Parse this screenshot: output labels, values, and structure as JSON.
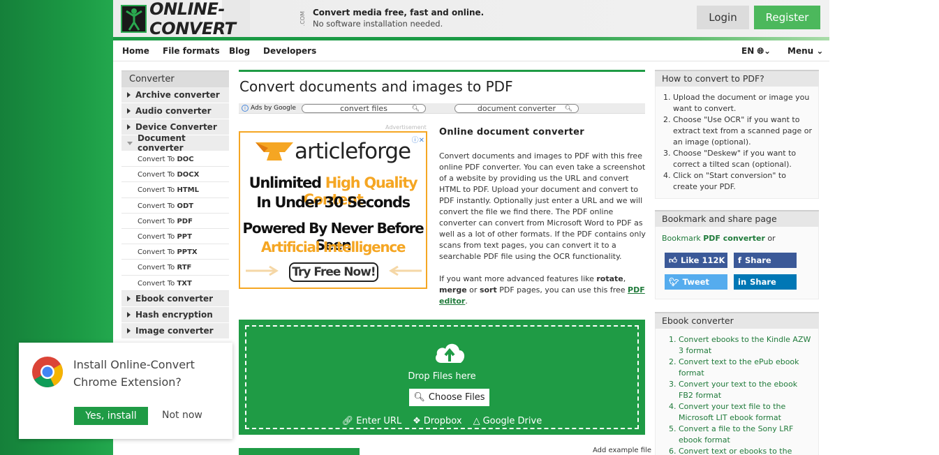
{
  "brand": {
    "logo_text": "ONLINE-CONVERT",
    "logo_suffix": ".COM",
    "tagline_main": "Convert media free, fast and online.",
    "tagline_sub": "No software installation needed."
  },
  "auth": {
    "login": "Login",
    "register": "Register"
  },
  "nav": {
    "items": [
      "Home",
      "File formats",
      "Blog",
      "Developers"
    ],
    "language": "EN",
    "menu": "Menu"
  },
  "sidebar": {
    "title": "Converter",
    "categories": [
      {
        "label": "Archive converter",
        "expanded": false
      },
      {
        "label": "Audio converter",
        "expanded": false
      },
      {
        "label": "Device Converter",
        "expanded": false
      },
      {
        "label": "Document converter",
        "expanded": true
      }
    ],
    "sub_prefix": "Convert To",
    "sub_items": [
      "DOC",
      "DOCX",
      "HTML",
      "ODT",
      "PDF",
      "PPT",
      "PPTX",
      "RTF",
      "TXT"
    ],
    "after_categories": [
      {
        "label": "Ebook converter"
      },
      {
        "label": "Hash encryption"
      },
      {
        "label": "Image converter"
      }
    ]
  },
  "main": {
    "title": "Convert documents and images to PDF",
    "ads_by": "Ads by Google",
    "ad_pills": [
      "convert files",
      "document converter"
    ],
    "advertisement_label": "Advertisement",
    "ad": {
      "brand": "articleforge",
      "line1_a": "Unlimited ",
      "line1_b": "High Quality Content",
      "line2": "In Under 30 Seconds",
      "line3": "Powered By Never Before Seen",
      "line4": "Artificial Intelligence",
      "cta": "Try Free Now!"
    },
    "desc_title": "Online document converter",
    "desc_p1": "Convert documents and images to PDF with this free online PDF converter. You can even take a screenshot of a website by providing us the URL and convert HTML to PDF. Upload your document and convert to PDF instantly. Optionally just enter a URL and we will convert the file we find there. The PDF online converter can convert from Microsoft Word to PDF as well as a lot of other formats. If the PDF contains only scans from text pages, you can convert it to a searchable PDF file using the OCR functionality.",
    "desc_p2_a": "If you want more advanced features like ",
    "desc_p2_rotate": "rotate",
    "desc_p2_comma": ", ",
    "desc_p2_merge": "merge",
    "desc_p2_or": " or ",
    "desc_p2_sort": "sort",
    "desc_p2_b": " PDF pages, you can use this free ",
    "desc_p2_link": "PDF editor",
    "desc_p2_end": ".",
    "dropzone": {
      "drop_text": "Drop Files here",
      "choose": "Choose Files",
      "enter_url": "Enter URL",
      "dropbox": "Dropbox",
      "gdrive": "Google Drive"
    },
    "add_example": "Add example file"
  },
  "right": {
    "howto_title": "How to convert to PDF?",
    "howto_steps": [
      "Upload the document or image you want to convert.",
      "Choose \"Use OCR\" if you want to extract text from a scanned page or an image (optional).",
      "Choose \"Deskew\" if you want to correct a tilted scan (optional).",
      "Click on \"Start conversion\" to create your PDF."
    ],
    "bookmark_title": "Bookmark and share page",
    "bookmark_text_a": "Bookmark ",
    "bookmark_link": "PDF converter",
    "bookmark_text_b": " or",
    "social": {
      "fb_like": "Like 112K",
      "fb_share": "Share",
      "tweet": "Tweet",
      "li_share": "Share"
    },
    "ebook_title": "Ebook converter",
    "ebook_items": [
      "Convert ebooks to the Kindle AZW 3 format",
      "Convert text to the ePub ebook format",
      "Convert your text to the ebook FB2 format",
      "Convert your text file to the Microsoft LIT ebook format",
      "Convert a file to the Sony LRF ebook format",
      "Convert text or ebooks to the"
    ]
  },
  "popup": {
    "line1": "Install Online-Convert",
    "line2": "Chrome Extension?",
    "yes": "Yes, install",
    "no": "Not now"
  },
  "colors": {
    "brand_green": "#1f9b45",
    "register_green": "#4cb85c",
    "link_green": "#1f7a3a",
    "ad_orange": "#f5a623"
  }
}
